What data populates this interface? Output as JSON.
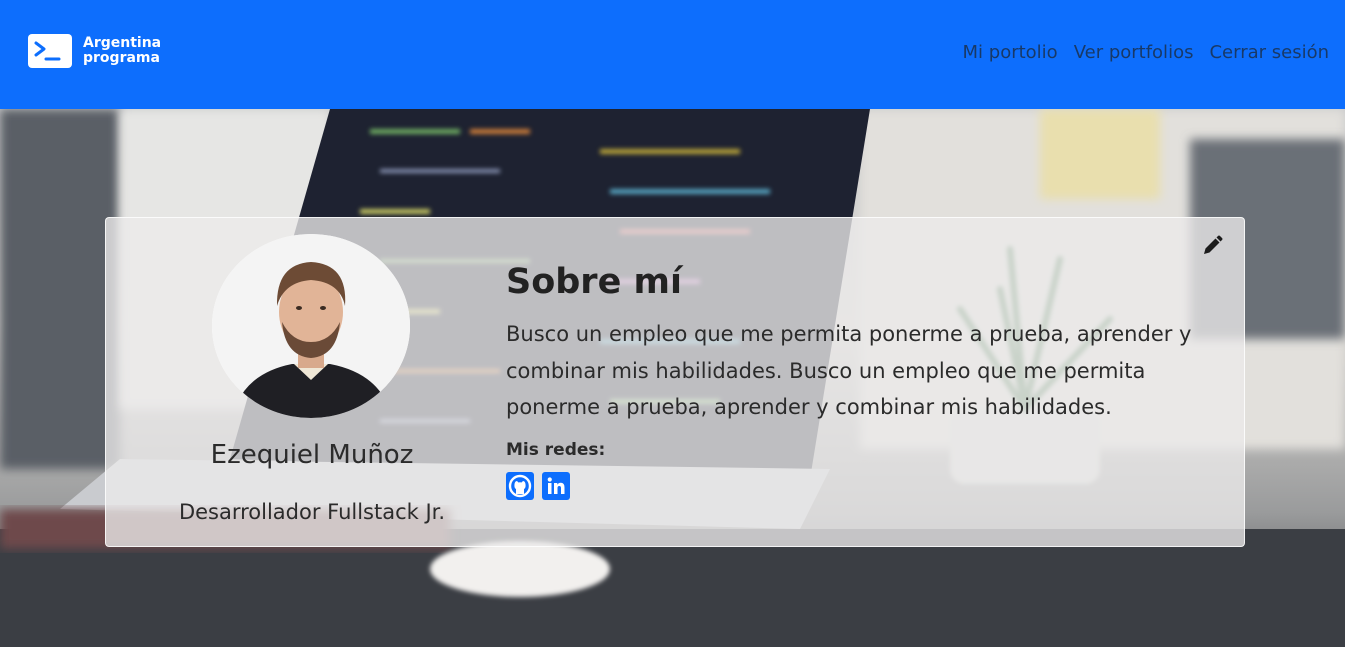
{
  "brand": {
    "line1": "Argentina",
    "line2": "programa",
    "icon": "terminal-prompt-icon"
  },
  "nav": {
    "items": [
      {
        "label": "Mi portolio"
      },
      {
        "label": "Ver portfolios"
      },
      {
        "label": "Cerrar sesión"
      }
    ]
  },
  "profile": {
    "name": "Ezequiel Muñoz",
    "role": "Desarrollador Fullstack Jr."
  },
  "about": {
    "title": "Sobre mí",
    "text": "Busco un empleo que me permita ponerme a prueba, aprender y combinar mis habilidades. Busco un empleo que me permita ponerme a prueba, aprender y combinar mis habilidades.",
    "edit_icon": "pencil-icon"
  },
  "social": {
    "label": "Mis redes:",
    "icons": [
      "github-icon",
      "linkedin-icon"
    ]
  },
  "colors": {
    "primary": "#0d6efd",
    "nav_text": "#1c2b3d"
  }
}
